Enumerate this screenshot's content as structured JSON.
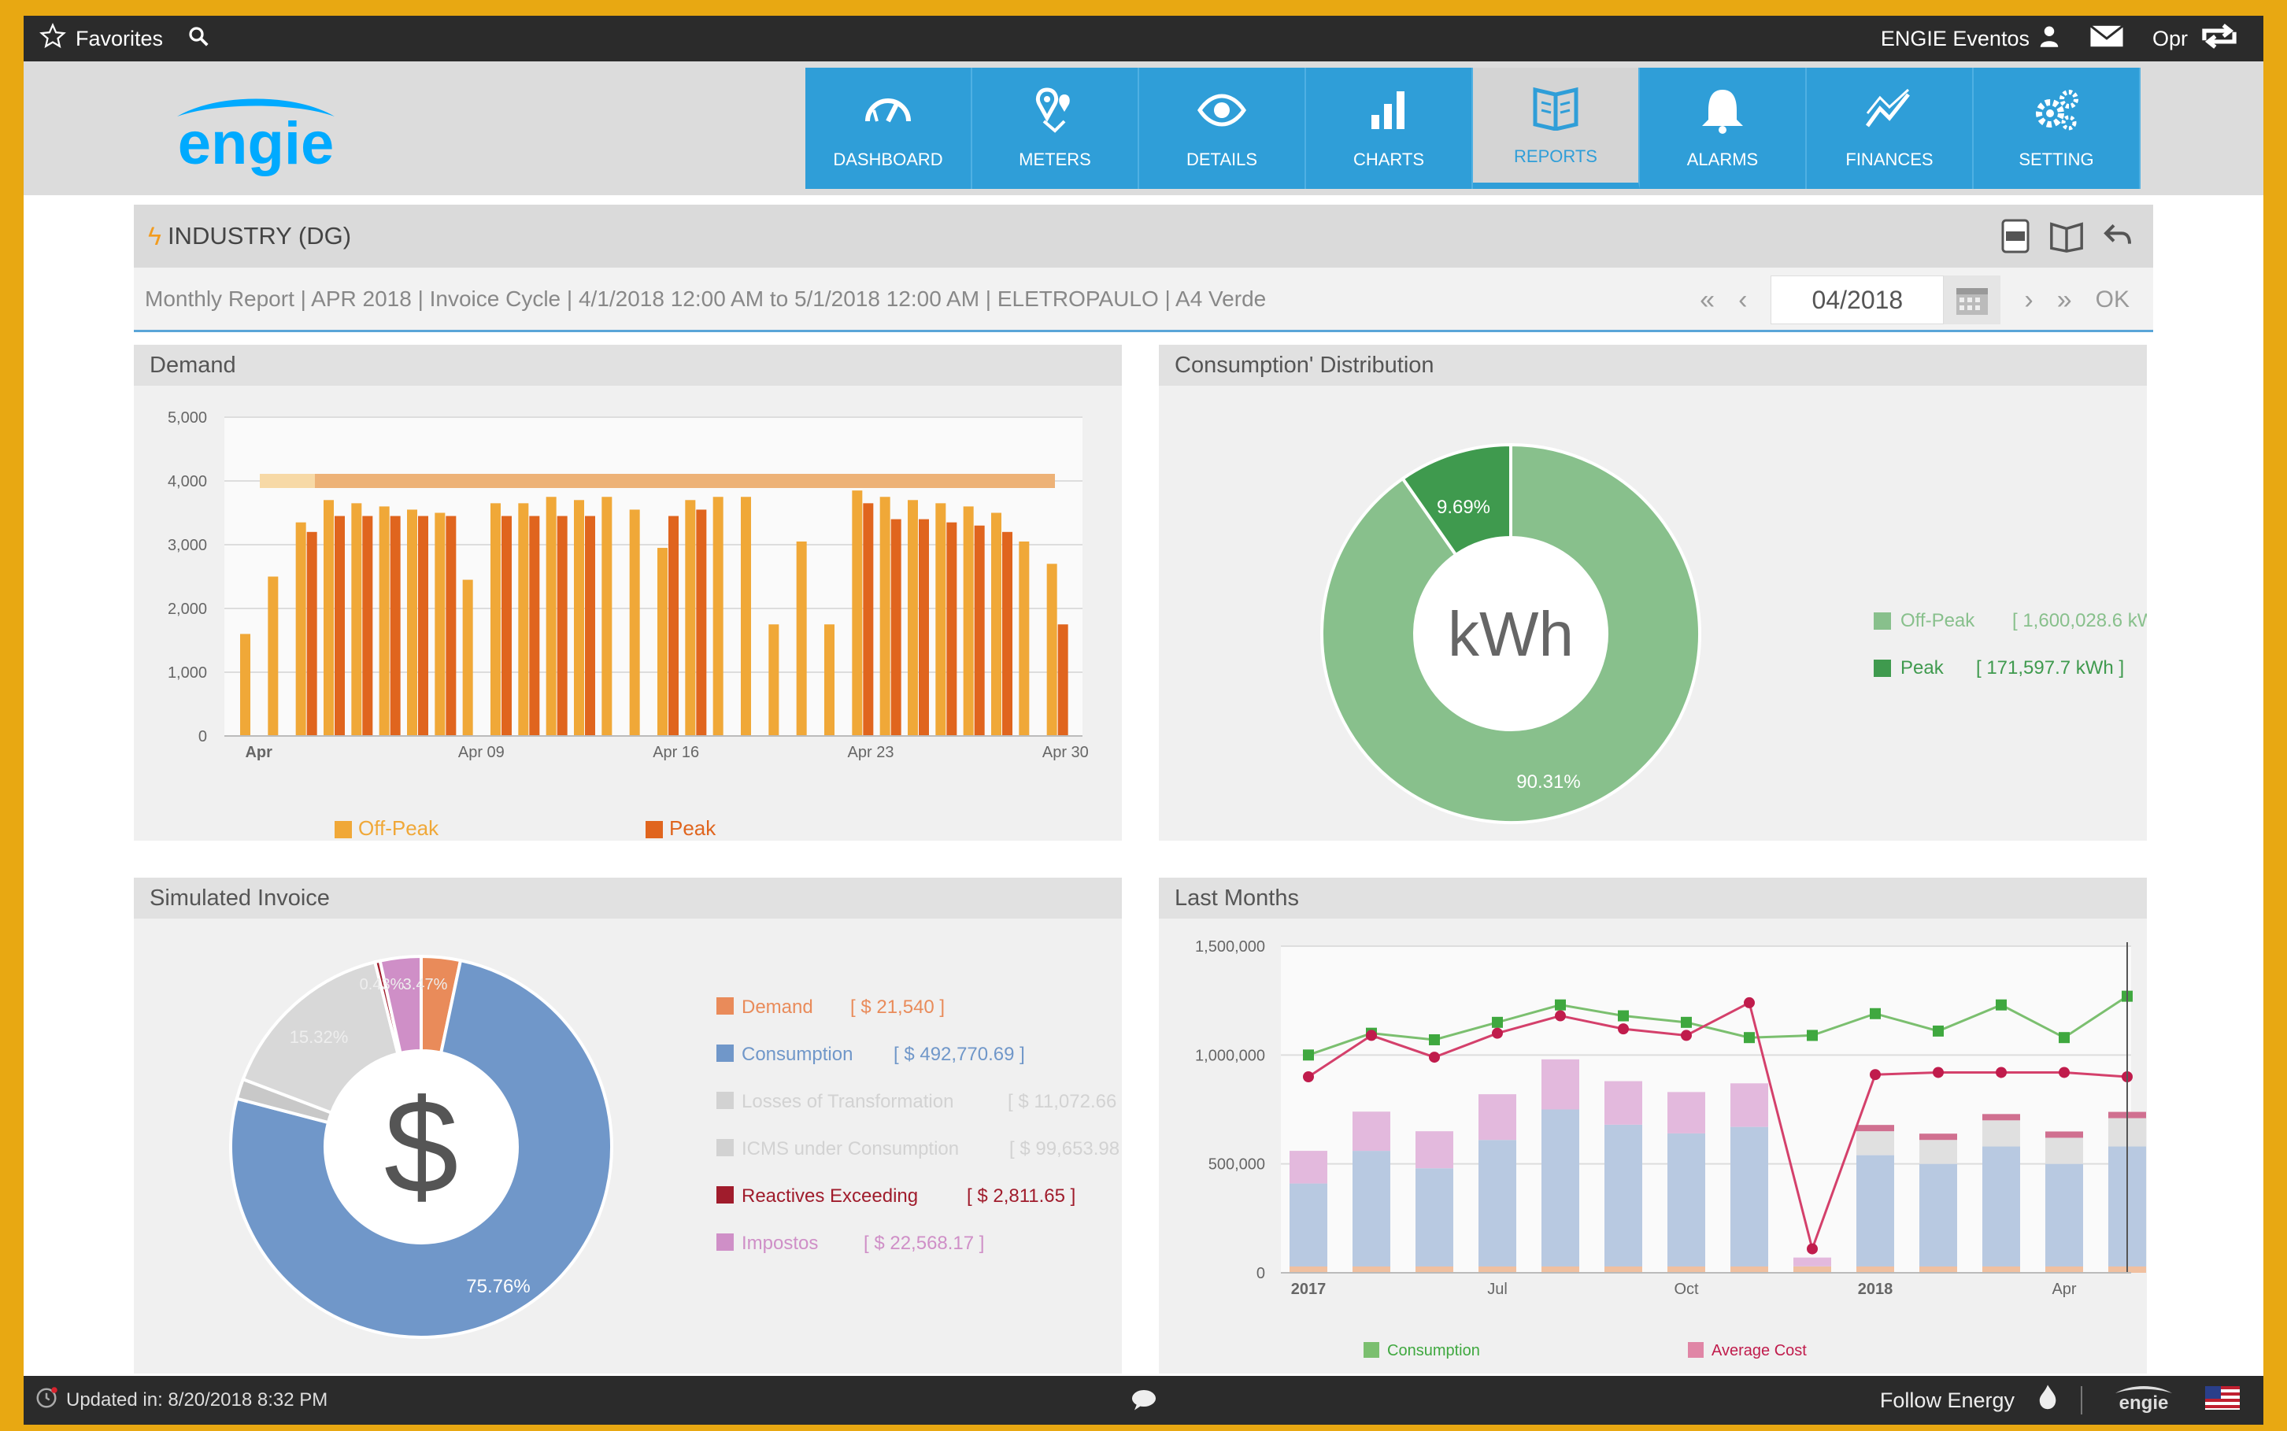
{
  "topbar": {
    "favorites_label": "Favorites",
    "user_label": "ENGIE Eventos",
    "opr_label": "Opr"
  },
  "brand": {
    "logo_text": "engie",
    "logo_color": "#00aaff"
  },
  "nav": {
    "items": [
      {
        "label": "DASHBOARD",
        "icon": "gauge-icon",
        "active": false
      },
      {
        "label": "METERS",
        "icon": "map-pins-icon",
        "active": false
      },
      {
        "label": "DETAILS",
        "icon": "eye-icon",
        "active": false
      },
      {
        "label": "CHARTS",
        "icon": "bar-chart-icon",
        "active": false
      },
      {
        "label": "REPORTS",
        "icon": "book-icon",
        "active": true
      },
      {
        "label": "ALARMS",
        "icon": "bell-icon",
        "active": false
      },
      {
        "label": "FINANCES",
        "icon": "trend-icon",
        "active": false
      },
      {
        "label": "SETTING",
        "icon": "gears-icon",
        "active": false
      }
    ]
  },
  "report": {
    "title": "INDUSTRY (DG)",
    "description": "Monthly Report | APR 2018 | Invoice Cycle | 4/1/2018 12:00 AM to 5/1/2018 12:00 AM | ELETROPAULO | A4 Verde",
    "period": "04/2018",
    "ok_label": "OK"
  },
  "panels": {
    "demand": "Demand",
    "distribution": "Consumption' Distribution",
    "invoice": "Simulated Invoice",
    "last_months": "Last Months"
  },
  "colors": {
    "offpeak": "#f0a838",
    "peak": "#e0651e",
    "green_light": "#88c08c",
    "green_dark": "#3f9a4e",
    "blue": "#7097c9",
    "pink": "#cf8fc7",
    "dark_red": "#a01c2c",
    "orange_soft": "#e98b5a"
  },
  "chart_data": [
    {
      "type": "bar",
      "title": "Demand",
      "xlabel": "",
      "ylabel": "",
      "ylim": [
        0,
        5000
      ],
      "yticks": [
        "5,000",
        "4,000",
        "3,000",
        "2,000",
        "1,000",
        "0"
      ],
      "x_tick_labels": [
        "Apr",
        "Apr 09",
        "Apr 16",
        "Apr 23",
        "Apr 30"
      ],
      "x_tick_days": [
        1,
        9,
        16,
        23,
        30
      ],
      "contracted_demand": 4000,
      "legend": [
        "Off-Peak",
        "Peak"
      ],
      "legend_position": "bottom",
      "series": [
        {
          "name": "Off-Peak",
          "values": [
            1600,
            2500,
            3350,
            3700,
            3650,
            3600,
            3550,
            3500,
            2450,
            3650,
            3650,
            3750,
            3700,
            3750,
            3550,
            2950,
            3700,
            3750,
            3750,
            1750,
            3050,
            1750,
            3850,
            3750,
            3700,
            3650,
            3600,
            3500,
            3050,
            2700
          ]
        },
        {
          "name": "Peak",
          "values": [
            0,
            0,
            3200,
            3450,
            3450,
            3450,
            3450,
            3450,
            0,
            3450,
            3450,
            3450,
            3450,
            0,
            0,
            3450,
            3550,
            0,
            0,
            0,
            0,
            0,
            3650,
            3400,
            3400,
            3350,
            3300,
            3200,
            0,
            1750
          ]
        }
      ]
    },
    {
      "type": "pie",
      "title": "Consumption' Distribution",
      "center_label": "kWh",
      "labels": [
        "Off-Peak",
        "Peak"
      ],
      "values_text": [
        "[ 1,600,028.6 kW",
        "[ 171,597.7 kWh ]"
      ],
      "values": [
        1600028.6,
        171597.7
      ],
      "percent_labels": [
        "90.31%",
        "9.69%"
      ],
      "legend_position": "right"
    },
    {
      "type": "pie",
      "title": "Simulated Invoice",
      "center_label": "$",
      "labels": [
        "Demand",
        "Consumption",
        "Losses of Transformation",
        "ICMS under Consumption",
        "Reactives Exceeding",
        "Impostos"
      ],
      "values_text": [
        "[ $ 21,540 ]",
        "[ $ 492,770.69 ]",
        "[ $ 11,072.66",
        "[ $ 99,653.98",
        "[ $ 2,811.65 ]",
        "[ $ 22,568.17 ]"
      ],
      "values": [
        21540,
        492770.69,
        11072.66,
        99653.98,
        2811.65,
        22568.17
      ],
      "percent_labels": [
        "",
        "75.76%",
        "",
        "15.32%",
        "0.43%",
        "3.47%"
      ],
      "legend_position": "right"
    },
    {
      "type": "bar",
      "title": "Last Months",
      "ylim": [
        0,
        1500000
      ],
      "yticks": [
        "1,500,000",
        "1,000,000",
        "500,000",
        "0"
      ],
      "x_tick_labels": [
        "2017",
        "Jul",
        "Oct",
        "2018",
        "Apr"
      ],
      "legend": [
        "Consumption",
        "Average Cost"
      ],
      "legend_position": "bottom",
      "stack_consumption": [
        410000,
        560000,
        480000,
        610000,
        750000,
        680000,
        640000,
        670000,
        30000,
        540000,
        500000,
        580000,
        500000,
        580000
      ],
      "stack_peak_energy": [
        150000,
        180000,
        170000,
        210000,
        230000,
        200000,
        190000,
        200000,
        40000,
        0,
        0,
        0,
        0,
        0
      ],
      "stack_losses": [
        0,
        0,
        0,
        0,
        0,
        0,
        0,
        0,
        0,
        110000,
        110000,
        120000,
        120000,
        130000
      ],
      "series": [
        {
          "name": "Consumption",
          "values": [
            1000000,
            1100000,
            1070000,
            1150000,
            1230000,
            1180000,
            1150000,
            1080000,
            1090000,
            1190000,
            1110000,
            1230000,
            1080000,
            1270000
          ]
        },
        {
          "name": "Average Cost",
          "values": [
            900000,
            1090000,
            990000,
            1100000,
            1180000,
            1120000,
            1090000,
            1240000,
            110000,
            910000,
            920000,
            920000,
            920000,
            900000
          ]
        }
      ]
    }
  ],
  "footer": {
    "updated": "Updated in: 8/20/2018 8:32 PM",
    "follow": "Follow Energy",
    "logo": "engie"
  }
}
